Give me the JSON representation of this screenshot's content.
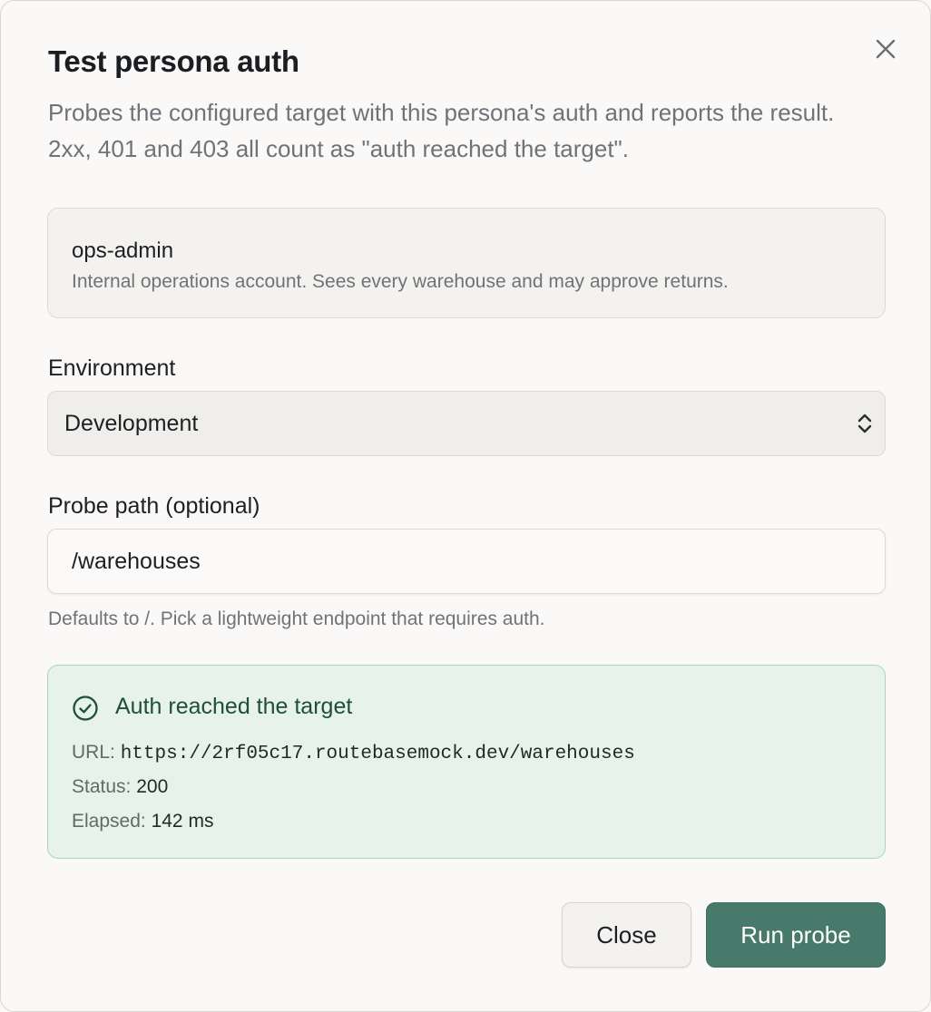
{
  "dialog": {
    "title": "Test persona auth",
    "description": "Probes the configured target with this persona's auth and reports the result. 2xx, 401 and 403 all count as \"auth reached the target\".",
    "close_icon": "close-icon"
  },
  "persona": {
    "name": "ops-admin",
    "description": "Internal operations account. Sees every warehouse and may approve returns."
  },
  "environment": {
    "label": "Environment",
    "selected": "Development",
    "icon": "chevron-up-down-icon"
  },
  "probe_path": {
    "label": "Probe path (optional)",
    "value": "/warehouses",
    "helper": "Defaults to /. Pick a lightweight endpoint that requires auth."
  },
  "result": {
    "icon": "check-circle-icon",
    "title": "Auth reached the target",
    "url_label": "URL:",
    "url_value": "https://2rf05c17.routebasemock.dev/warehouses",
    "status_label": "Status:",
    "status_value": "200",
    "elapsed_label": "Elapsed:",
    "elapsed_value": "142 ms"
  },
  "actions": {
    "close_label": "Close",
    "run_label": "Run probe"
  },
  "colors": {
    "accent": "#487a6c",
    "success_bg": "#e6f2eb",
    "success_border": "#a9d5bb",
    "success_text": "#1f4e3c"
  }
}
